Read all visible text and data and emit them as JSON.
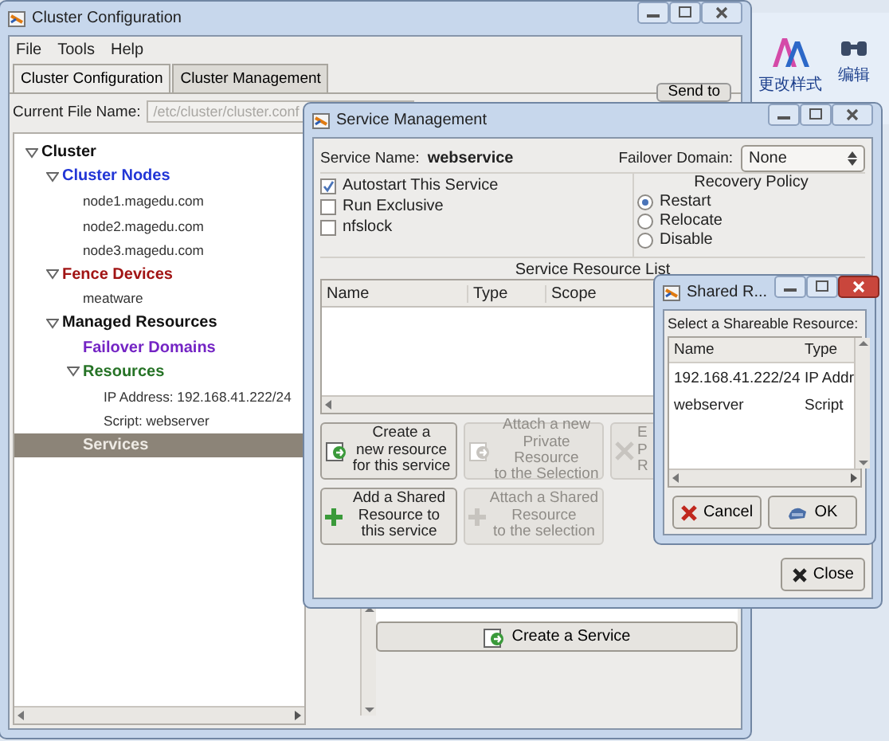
{
  "background_app": {
    "ribbon_buttons": [
      {
        "label": "更改样式",
        "kind": "styles"
      },
      {
        "label": "编辑",
        "kind": "find"
      }
    ]
  },
  "main_window": {
    "title": "Cluster Configuration",
    "menu": [
      "File",
      "Tools",
      "Help"
    ],
    "tabs": [
      {
        "label": "Cluster Configuration",
        "selected": true
      },
      {
        "label": "Cluster Management",
        "selected": false
      }
    ],
    "file_name": {
      "label": "Current File Name:",
      "value": "/etc/cluster/cluster.conf"
    },
    "send_button": "Send to",
    "tree": [
      {
        "label": "Cluster",
        "kind": "group",
        "expanded": true,
        "selected": false,
        "children": [
          {
            "label": "Cluster Nodes",
            "kind": "group",
            "color": "#2236d6",
            "expanded": true,
            "selected": false,
            "children": [
              {
                "label": "node1.magedu.com",
                "kind": "node",
                "selected": false
              },
              {
                "label": "node2.magedu.com",
                "kind": "node",
                "selected": false
              },
              {
                "label": "node3.magedu.com",
                "kind": "node",
                "selected": false
              }
            ]
          },
          {
            "label": "Fence Devices",
            "kind": "group",
            "color": "#a11414",
            "expanded": true,
            "selected": false,
            "children": [
              {
                "label": "meatware",
                "kind": "node",
                "selected": false
              }
            ]
          },
          {
            "label": "Managed Resources",
            "kind": "group",
            "expanded": true,
            "selected": false,
            "children": [
              {
                "label": "Failover Domains",
                "kind": "group",
                "color": "#7424c4",
                "selected": false
              },
              {
                "label": "Resources",
                "kind": "group",
                "color": "#267326",
                "expanded": true,
                "selected": false,
                "children": [
                  {
                    "label": "IP Address: 192.168.41.222/24",
                    "kind": "node",
                    "selected": false
                  },
                  {
                    "label": "Script: webserver",
                    "kind": "node",
                    "selected": false
                  }
                ]
              },
              {
                "label": "Services",
                "kind": "group",
                "selected": true
              }
            ]
          }
        ]
      }
    ],
    "create_service_button": "Create a Service"
  },
  "service_dialog": {
    "title": "Service Management",
    "service_name_label": "Service Name:",
    "service_name": "webservice",
    "failover_label": "Failover Domain:",
    "failover_value": "None",
    "options": [
      {
        "label": "Autostart This Service",
        "checked": true
      },
      {
        "label": "Run Exclusive",
        "checked": false
      },
      {
        "label": "nfslock",
        "checked": false
      }
    ],
    "recovery_title": "Recovery Policy",
    "recovery": [
      {
        "label": "Restart",
        "selected": true
      },
      {
        "label": "Relocate",
        "selected": false
      },
      {
        "label": "Disable",
        "selected": false
      }
    ],
    "resource_list_title": "Service Resource List",
    "columns": [
      "Name",
      "Type",
      "Scope"
    ],
    "actions": [
      {
        "label": "Create a\nnew resource\nfor this service",
        "kind": "new",
        "disabled": false
      },
      {
        "label": "Attach a new\nPrivate Resource\nto the Selection",
        "kind": "attach",
        "disabled": true
      },
      {
        "label": "E\nP\nR",
        "kind": "edit",
        "disabled": true
      },
      {
        "label": "Add a Shared\nResource to\nthis service",
        "kind": "add",
        "disabled": false
      },
      {
        "label": "Attach a Shared\nResource\nto the selection",
        "kind": "add",
        "disabled": true
      }
    ],
    "close_button": "Close"
  },
  "shared_dialog": {
    "title": "Shared R...",
    "prompt": "Select a Shareable Resource:",
    "columns": [
      "Name",
      "Type"
    ],
    "rows": [
      {
        "name": "192.168.41.222/24",
        "type": "IP Addr"
      },
      {
        "name": "webserver",
        "type": "Script"
      }
    ],
    "cancel_button": "Cancel",
    "ok_button": "OK"
  }
}
